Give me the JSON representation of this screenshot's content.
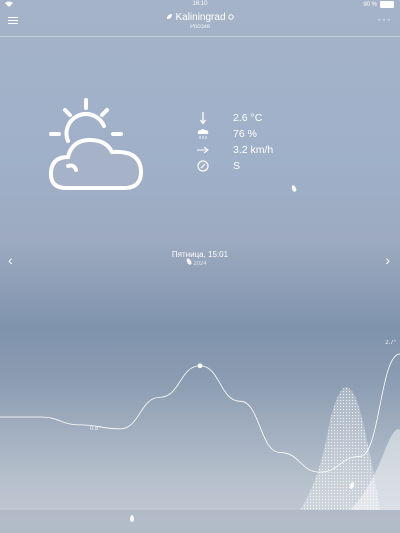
{
  "status_bar": {
    "time": "16:10",
    "battery": "90 %"
  },
  "header": {
    "city": "Kaliningrad",
    "country": "Россия"
  },
  "current": {
    "icon": "partly-cloudy-icon",
    "temperature": "2.6 °C",
    "humidity": "76 %",
    "wind_speed": "3.2 km/h",
    "wind_direction": "S"
  },
  "date": {
    "main": "Пятница, 15:01",
    "sub": "2024"
  },
  "chart_labels": {
    "min": "0.8°",
    "max": "2.7°"
  },
  "chart_data": {
    "type": "line",
    "title": "",
    "xlabel": "",
    "ylabel": "",
    "series": [
      {
        "values": [
          1.1,
          1.1,
          0.9,
          0.8,
          1.6,
          2.4,
          1.5,
          0.2,
          -0.3,
          0.1,
          2.7
        ]
      }
    ]
  }
}
